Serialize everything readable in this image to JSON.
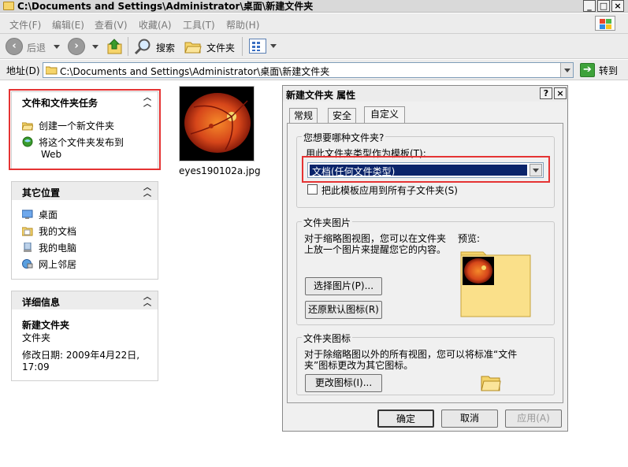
{
  "window": {
    "title": "C:\\Documents and Settings\\Administrator\\桌面\\新建文件夹"
  },
  "menu": [
    "文件(F)",
    "编辑(E)",
    "查看(V)",
    "收藏(A)",
    "工具(T)",
    "帮助(H)"
  ],
  "toolbar": {
    "back": "后退",
    "search": "搜索",
    "folders": "文件夹"
  },
  "address": {
    "label": "地址(D)",
    "path": "C:\\Documents and Settings\\Administrator\\桌面\\新建文件夹",
    "go": "转到"
  },
  "tasks": {
    "title": "文件和文件夹任务",
    "items": [
      "创建一个新文件夹",
      "将这个文件夹发布到",
      "Web"
    ]
  },
  "places": {
    "title": "其它位置",
    "items": [
      "桌面",
      "我的文档",
      "我的电脑",
      "网上邻居"
    ]
  },
  "details": {
    "title": "详细信息",
    "name": "新建文件夹",
    "type": "文件夹",
    "modified_label": "修改日期: 2009年4月22日,",
    "modified_time": "17:09"
  },
  "file": {
    "name": "eyes190102a.jpg"
  },
  "dialog": {
    "title": "新建文件夹 属性",
    "tabs": [
      "常规",
      "安全",
      "自定义"
    ],
    "active_tab": "自定义",
    "group_type": {
      "label": "您想要哪种文件夹?",
      "template_label": "用此文件夹类型作为模板(T):",
      "template_value": "文档(任何文件类型)",
      "apply_all": "把此模板应用到所有子文件夹(S)"
    },
    "group_pictures": {
      "label": "文件夹图片",
      "desc1": "对于缩略图视图，您可以在文件夹",
      "desc2": "上放一个图片来提醒您它的内容。",
      "preview_label": "预览:",
      "choose_btn": "选择图片(P)...",
      "restore_btn": "还原默认图标(R)"
    },
    "group_icon": {
      "label": "文件夹图标",
      "desc1": "对于除缩略图以外的所有视图，您可以将标准“文件",
      "desc2": "夹”图标更改为其它图标。",
      "change_btn": "更改图标(I)..."
    },
    "buttons": {
      "ok": "确定",
      "cancel": "取消",
      "apply": "应用(A)"
    }
  },
  "colors": {
    "highlight_red": "#e53333",
    "selection_blue": "#0a246a",
    "folder_yellow": "#f6d56b"
  }
}
